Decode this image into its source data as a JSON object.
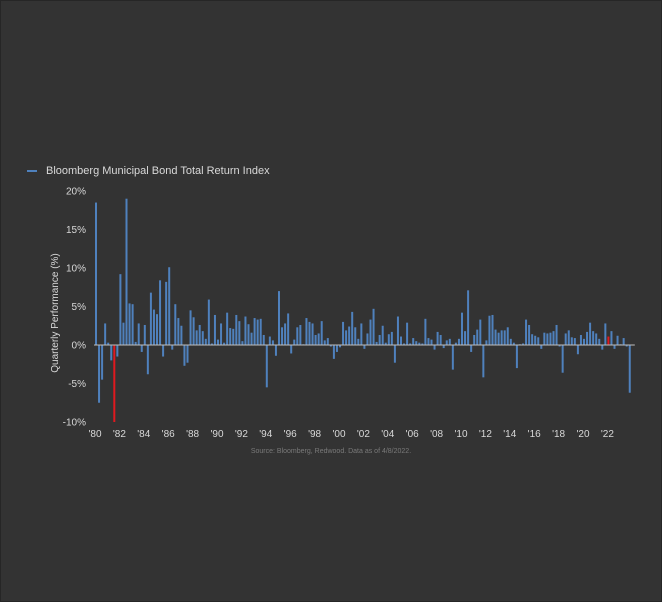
{
  "chart_data": {
    "type": "bar",
    "legend": "Bloomberg Municipal Bond Total Return Index",
    "ylabel": "Quarterly Performance (%)",
    "ylim": [
      -10,
      20
    ],
    "yticks": [
      "-10%",
      "-5%",
      "0%",
      "5%",
      "10%",
      "15%",
      "20%"
    ],
    "xticks": [
      "'80",
      "'82",
      "'84",
      "'86",
      "'88",
      "'90",
      "'92",
      "'94",
      "'96",
      "'98",
      "'00",
      "'02",
      "'04",
      "'06",
      "'08",
      "'10",
      "'12",
      "'14",
      "'16",
      "'18",
      "'20",
      "'22"
    ],
    "x_start_year": 1980,
    "highlight_color": "#e0191f",
    "bar_color": "#4f81bd",
    "highlighted_quarters": [
      "1981Q3",
      "2022Q1"
    ],
    "source": "Source: Bloomberg, Redwood. Data as of 4/8/2022.",
    "values": [
      18.5,
      -7.5,
      -4.5,
      2.8,
      0.3,
      -2.0,
      -10.0,
      -1.5,
      9.2,
      2.9,
      19.0,
      5.4,
      5.3,
      0.4,
      2.8,
      -0.9,
      2.6,
      -3.8,
      6.8,
      4.6,
      4.0,
      8.4,
      -1.5,
      8.2,
      10.1,
      -0.6,
      5.3,
      3.5,
      2.5,
      -2.7,
      -2.3,
      4.5,
      3.6,
      1.9,
      2.6,
      1.8,
      0.8,
      5.9,
      0.2,
      3.9,
      0.7,
      2.8,
      0.3,
      4.2,
      2.2,
      2.1,
      3.9,
      3.1,
      0.5,
      3.7,
      2.7,
      1.6,
      3.5,
      3.3,
      3.4,
      1.3,
      -5.5,
      1.1,
      0.6,
      -1.4,
      7.0,
      2.3,
      2.8,
      4.1,
      -1.1,
      0.7,
      2.3,
      2.6,
      0.1,
      3.5,
      3.0,
      2.8,
      1.3,
      1.5,
      3.1,
      0.6,
      0.9,
      -0.2,
      -1.8,
      -0.9,
      -0.3,
      3.0,
      1.9,
      2.4,
      4.3,
      2.3,
      0.8,
      2.8,
      -0.5,
      1.5,
      3.3,
      4.7,
      0.4,
      1.3,
      2.5,
      0.3,
      1.4,
      1.7,
      -2.3,
      3.7,
      1.1,
      0.2,
      2.9,
      0.2,
      0.9,
      0.5,
      0.3,
      0.2,
      3.4,
      0.9,
      0.7,
      -0.6,
      1.7,
      1.3,
      -0.4,
      0.6,
      0.8,
      -3.2,
      0.3,
      0.8,
      4.2,
      1.8,
      7.1,
      -0.9,
      1.3,
      2.0,
      3.3,
      -4.2,
      0.6,
      3.8,
      3.9,
      2.0,
      1.6,
      1.9,
      1.9,
      2.3,
      0.8,
      0.3,
      -3.0,
      0.1,
      0.2,
      3.3,
      2.6,
      1.4,
      1.2,
      1.0,
      -0.5,
      1.6,
      1.5,
      1.6,
      1.8,
      2.6,
      -0.2,
      -3.6,
      1.5,
      1.9,
      1.0,
      0.9,
      -1.2,
      1.3,
      0.8,
      1.7,
      2.9,
      1.8,
      1.5,
      0.8,
      -0.6,
      2.8,
      1.1,
      1.8,
      -0.5,
      1.2,
      0.1,
      0.9,
      -0.2,
      -6.2
    ]
  }
}
